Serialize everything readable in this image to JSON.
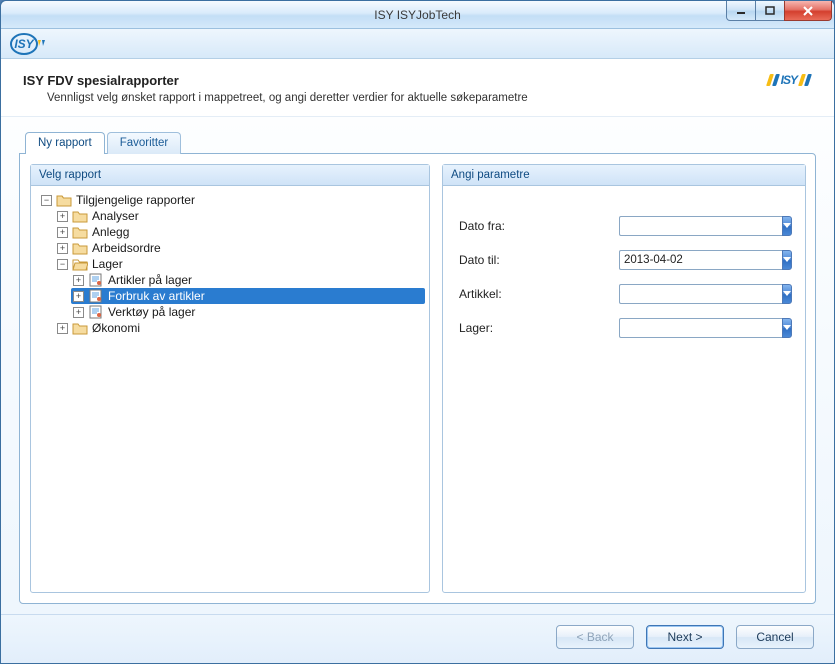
{
  "window": {
    "title": "ISY ISYJobTech"
  },
  "header": {
    "title": "ISY FDV spesialrapporter",
    "subtitle": "Vennligst velg ønsket rapport i mappetreet, og angi deretter verdier for aktuelle søkeparametre",
    "logo_text": "ISY"
  },
  "tabs": {
    "items": [
      {
        "label": "Ny rapport",
        "active": true
      },
      {
        "label": "Favoritter",
        "active": false
      }
    ]
  },
  "tree": {
    "title": "Velg rapport",
    "root": {
      "label": "Tilgjengelige rapporter",
      "expanded": true,
      "children": [
        {
          "label": "Analyser",
          "type": "folder",
          "expanded": false,
          "has_children": true
        },
        {
          "label": "Anlegg",
          "type": "folder",
          "expanded": false,
          "has_children": true
        },
        {
          "label": "Arbeidsordre",
          "type": "folder",
          "expanded": false,
          "has_children": true
        },
        {
          "label": "Lager",
          "type": "folder",
          "expanded": true,
          "has_children": true,
          "children": [
            {
              "label": "Artikler på lager",
              "type": "report",
              "has_children": true
            },
            {
              "label": "Forbruk av artikler",
              "type": "report",
              "selected": true,
              "has_children": true
            },
            {
              "label": "Verktøy på lager",
              "type": "report",
              "has_children": true
            }
          ]
        },
        {
          "label": "Økonomi",
          "type": "folder",
          "expanded": false,
          "has_children": true
        }
      ]
    }
  },
  "params": {
    "title": "Angi parametre",
    "rows": [
      {
        "label": "Dato fra:",
        "value": ""
      },
      {
        "label": "Dato til:",
        "value": "2013-04-02"
      },
      {
        "label": "Artikkel:",
        "value": ""
      },
      {
        "label": "Lager:",
        "value": ""
      }
    ]
  },
  "footer": {
    "back": "< Back",
    "next": "Next >",
    "cancel": "Cancel"
  }
}
